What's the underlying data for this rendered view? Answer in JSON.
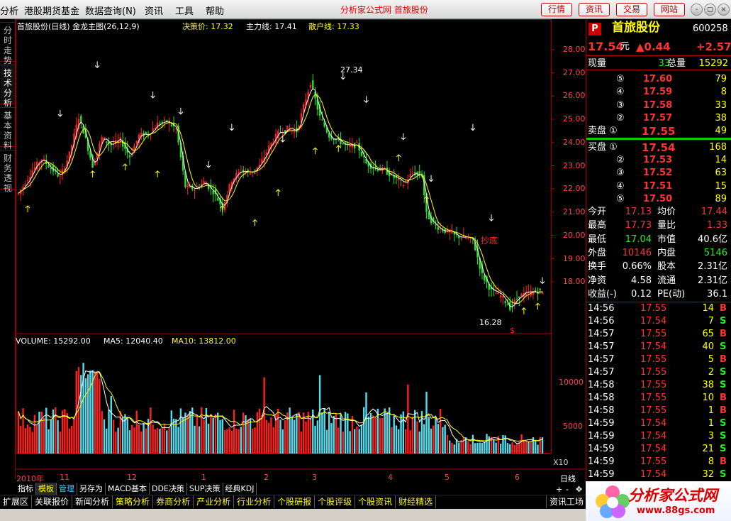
{
  "menubar": {
    "items": [
      "分析",
      "港股期货基金",
      "数据查询(N)",
      "资讯",
      "工具",
      "帮助"
    ],
    "center_links": "分析家公式网 首旅股份",
    "buttons": [
      "行情",
      "资讯",
      "交易",
      "网站"
    ],
    "window_controls": [
      "-",
      "◻",
      "×"
    ]
  },
  "sidetabs": [
    "分时走势",
    "技术分析",
    "基本资料",
    "财务透视"
  ],
  "chart": {
    "title": "首旅股份(日线) 金龙主图(26,12,9)",
    "ind1_label": "决策价: 17.32",
    "ind2_label": "主力线: 17.41",
    "ind3_label": "散户线: 17.33",
    "price_axis": [
      "28.00",
      "27.00",
      "26.00",
      "25.00",
      "24.00",
      "23.00",
      "22.00",
      "21.00",
      "20.00",
      "19.00",
      "18.00"
    ],
    "high_label": "27.34",
    "low_label": "16.28",
    "annot_bottom": "抄底",
    "sell_mark": "$",
    "vol_label": "VOLUME: 15292.00",
    "ma5_label": "MA5: 12040.40",
    "ma10_label": "MA10: 13812.00",
    "vol_axis": [
      "10000",
      "5000"
    ],
    "vol_unit": "X10",
    "date_axis": [
      "2010年",
      "11",
      "12",
      "1",
      "2",
      "3",
      "4",
      "5",
      "6"
    ],
    "period": "日线",
    "zoom": [
      "+",
      "-",
      "✥"
    ]
  },
  "chart_data": {
    "type": "candlestick",
    "title": "首旅股份(日线)",
    "ylim": [
      16,
      28.5
    ],
    "vol_ylim": [
      0,
      14000
    ],
    "high": 27.34,
    "low": 16.28,
    "last_volume": 15292,
    "ma5": 12040.4,
    "ma10": 13812
  },
  "quote": {
    "logo": "P",
    "name": "首旅股份",
    "code": "600258",
    "price": "17.54",
    "unit": "元",
    "change": "▲0.44",
    "change2": "+2.57",
    "xianliang_label": "现量",
    "xianliang": "33",
    "zongliang_label": "总量",
    "zongliang": "15292",
    "asks": [
      {
        "lvl": "⑤",
        "p": "17.60",
        "v": "79"
      },
      {
        "lvl": "④",
        "p": "17.59",
        "v": "8"
      },
      {
        "lvl": "③",
        "p": "17.58",
        "v": "33"
      },
      {
        "lvl": "②",
        "p": "17.57",
        "v": "38"
      }
    ],
    "sell1_label": "卖盘 ①",
    "sell1_p": "17.55",
    "sell1_v": "49",
    "buy1_label": "买盘 ①",
    "buy1_p": "17.54",
    "buy1_v": "168",
    "bids": [
      {
        "lvl": "②",
        "p": "17.53",
        "v": "14"
      },
      {
        "lvl": "③",
        "p": "17.52",
        "v": "63"
      },
      {
        "lvl": "④",
        "p": "17.51",
        "v": "15"
      },
      {
        "lvl": "⑤",
        "p": "17.50",
        "v": "89"
      }
    ],
    "stats": [
      [
        "今开",
        "17.13",
        "均价",
        "17.44"
      ],
      [
        "最高",
        "17.73",
        "量比",
        "1.33"
      ],
      [
        "最低",
        "17.04",
        "市值",
        "40.6亿"
      ],
      [
        "外盘",
        "10146",
        "内盘",
        "5146"
      ],
      [
        "换手",
        "0.66%",
        "股本",
        "2.31亿"
      ],
      [
        "净资",
        "4.58",
        "流通",
        "2.31亿"
      ],
      [
        "收益(-)",
        "0.12",
        "PE(动)",
        "36.1"
      ]
    ],
    "ticks": [
      [
        "14:56",
        "17.55",
        "14",
        "B"
      ],
      [
        "14:56",
        "17.54",
        "7",
        "S"
      ],
      [
        "14:57",
        "17.55",
        "65",
        "B"
      ],
      [
        "14:57",
        "17.54",
        "40",
        "S"
      ],
      [
        "14:57",
        "17.55",
        "5",
        "B"
      ],
      [
        "14:57",
        "17.55",
        "2",
        "S"
      ],
      [
        "14:58",
        "17.55",
        "38",
        "S"
      ],
      [
        "14:58",
        "17.55",
        "10",
        "B"
      ],
      [
        "14:58",
        "17.55",
        "1",
        "B"
      ],
      [
        "14:59",
        "17.54",
        "1",
        "S"
      ],
      [
        "14:59",
        "17.54",
        "3",
        "S"
      ],
      [
        "14:59",
        "17.54",
        "21",
        "S"
      ],
      [
        "14:59",
        "17.55",
        "8",
        "B"
      ],
      [
        "14:59",
        "17.54",
        "32",
        "S"
      ]
    ]
  },
  "bottomtabs": [
    "指标",
    "模板",
    "管理",
    "另存为",
    "MACD基本",
    "DDE决策",
    "SUP决策",
    "经典KDJ"
  ],
  "statusbar": [
    "扩展区",
    "关联报价",
    "新闻分析",
    "策略分析",
    "券商分析",
    "产业分析",
    "行业分析",
    "个股研报",
    "个股评级",
    "个股资讯",
    "财经精选"
  ],
  "status_right": "资讯工场",
  "logo_text": "分析家公式网",
  "logo_url": "www.88gs.com",
  "colors": {
    "up": "#ff2020",
    "down": "#20e020",
    "yellow": "#ffff00",
    "cyan": "#55ddee",
    "bg": "#000000"
  }
}
